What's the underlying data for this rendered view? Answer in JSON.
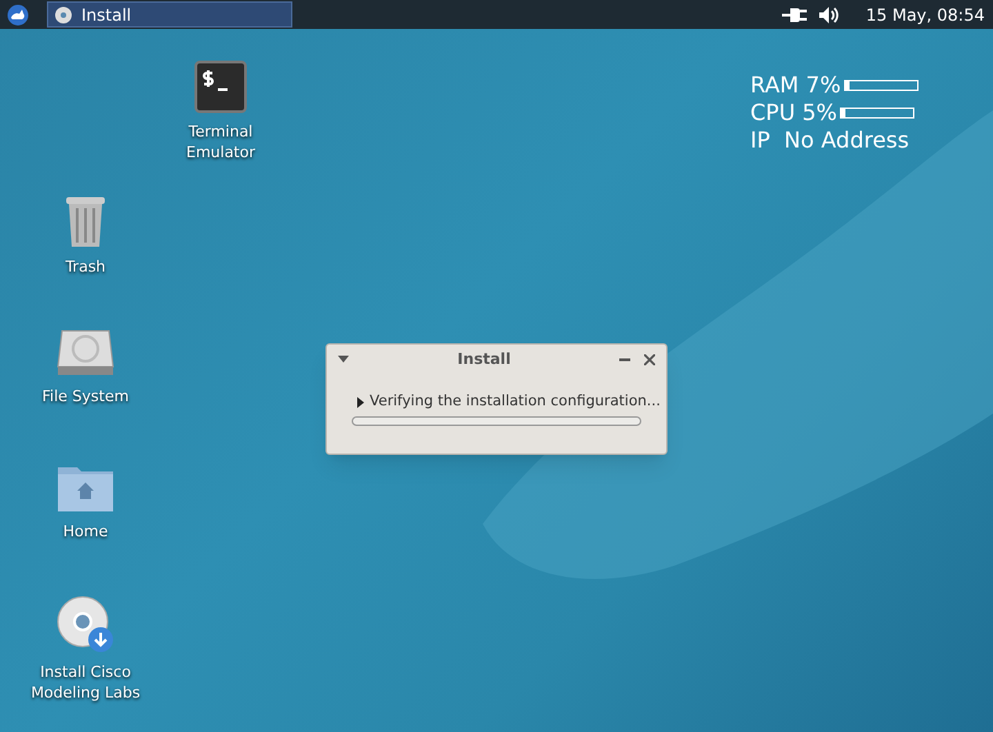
{
  "taskbar": {
    "windows": [
      {
        "label": "Install",
        "selected": true
      }
    ],
    "clock": "15 May, 08:54"
  },
  "monitor": {
    "meters": [
      {
        "label": "RAM 7%",
        "level": 0.07
      },
      {
        "label": "CPU 5%",
        "level": 0.05
      }
    ],
    "ip": "IP  No Address"
  },
  "desktop_icons": [
    {
      "kind": "terminal",
      "label": "Terminal\nEmulator"
    },
    {
      "kind": "trash",
      "label": "Trash"
    },
    {
      "kind": "drive",
      "label": "File System"
    },
    {
      "kind": "folder",
      "label": "Home"
    },
    {
      "kind": "disc",
      "label": "Install Cisco\nModeling Labs"
    }
  ],
  "dialog": {
    "title": "Install",
    "message": "Verifying the installation configuration...",
    "progress": {
      "level": 0
    }
  }
}
